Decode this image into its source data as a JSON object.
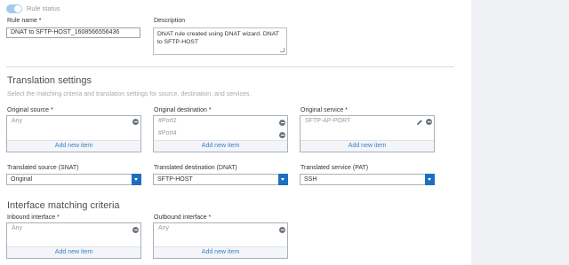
{
  "rule_status": {
    "label": "Rule status"
  },
  "rule_name": {
    "label": "Rule name *",
    "value": "DNAT to SFTP-HOST_1608566556436"
  },
  "description": {
    "label": "Description",
    "value": "DNAT rule created using DNAT wizard. DNAT to SFTP-HOST"
  },
  "translation_settings": {
    "title": "Translation settings",
    "subtitle": "Select the matching criteria and translation settings for source, destination, and services."
  },
  "original_source": {
    "label": "Original source *",
    "items": [
      "Any"
    ],
    "add_label": "Add new item"
  },
  "original_destination": {
    "label": "Original destination *",
    "items": [
      "#Port2",
      "#Port4"
    ],
    "add_label": "Add new item"
  },
  "original_service": {
    "label": "Original service *",
    "items": [
      "SFTP-AP-PORT"
    ],
    "add_label": "Add new item"
  },
  "translated_source": {
    "label": "Translated source (SNAT)",
    "value": "Original"
  },
  "translated_destination": {
    "label": "Translated destination (DNAT)",
    "value": "SFTP-HOST"
  },
  "translated_service": {
    "label": "Translated service (PAT)",
    "value": "SSH"
  },
  "interface_matching": {
    "title": "Interface matching criteria"
  },
  "inbound_interface": {
    "label": "Inbound interface *",
    "items": [
      "Any"
    ],
    "add_label": "Add new item"
  },
  "outbound_interface": {
    "label": "Outbound interface *",
    "items": [
      "Any"
    ],
    "add_label": "Add new item"
  }
}
